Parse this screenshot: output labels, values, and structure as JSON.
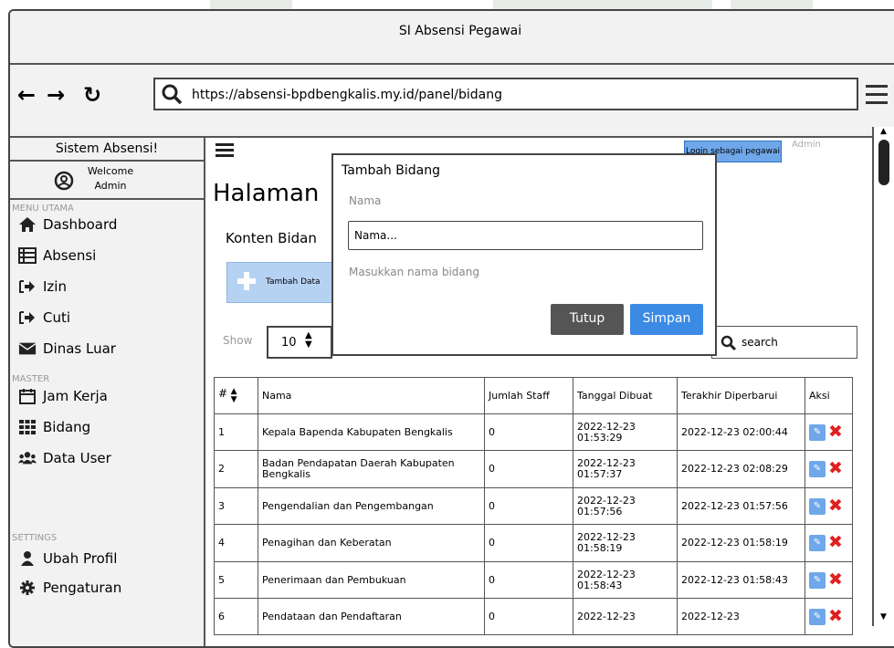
{
  "window": {
    "title": "SI Absensi Pegawai"
  },
  "browser": {
    "url": "https://absensi-bpdbengkalis.my.id/panel/bidang"
  },
  "sidebar": {
    "title": "Sistem Absensi!",
    "welcome_line1": "Welcome",
    "welcome_line2": "Admin",
    "section_main": "MENU UTAMA",
    "section_master": "MASTER",
    "section_settings": "SETTINGS",
    "items": [
      {
        "label": "Dashboard",
        "icon": "home-icon"
      },
      {
        "label": "Absensi",
        "icon": "list-icon"
      },
      {
        "label": "Izin",
        "icon": "sign-in-icon"
      },
      {
        "label": "Cuti",
        "icon": "sign-in-icon"
      },
      {
        "label": "Dinas Luar",
        "icon": "envelope-icon"
      },
      {
        "label": "Jam Kerja",
        "icon": "calendar-icon"
      },
      {
        "label": "Bidang",
        "icon": "grid-icon"
      },
      {
        "label": "Data User",
        "icon": "users-icon"
      },
      {
        "label": "Ubah Profil",
        "icon": "user-icon"
      },
      {
        "label": "Pengaturan",
        "icon": "gear-icon"
      }
    ]
  },
  "header": {
    "login_badge": "Login sebagai pegawai",
    "role": "Admin"
  },
  "main": {
    "page_title": "Halaman",
    "section_title": "Konten Bidan",
    "add_button": "Tambah Data",
    "show_label": "Show",
    "show_value": "10",
    "search_placeholder": "search"
  },
  "modal": {
    "title": "Tambah Bidang",
    "field_label": "Nama",
    "input_placeholder": "Nama...",
    "help_text": "Masukkan nama bidang",
    "close_button": "Tutup",
    "save_button": "Simpan"
  },
  "table": {
    "headers": {
      "no": "#",
      "nama": "Nama",
      "jumlah": "Jumlah Staff",
      "dibuat": "Tanggal Dibuat",
      "diperbarui": "Terakhir Diperbarui",
      "aksi": "Aksi"
    },
    "rows": [
      {
        "no": "1",
        "nama": "Kepala Bapenda Kabupaten Bengkalis",
        "jumlah": "0",
        "dibuat": "2022-12-23 01:53:29",
        "diperbarui": "2022-12-23 02:00:44"
      },
      {
        "no": "2",
        "nama": "Badan Pendapatan Daerah Kabupaten Bengkalis",
        "jumlah": "0",
        "dibuat": "2022-12-23 01:57:37",
        "diperbarui": "2022-12-23 02:08:29"
      },
      {
        "no": "3",
        "nama": "Pengendalian dan Pengembangan",
        "jumlah": "0",
        "dibuat": "2022-12-23 01:57:56",
        "diperbarui": "2022-12-23 01:57:56"
      },
      {
        "no": "4",
        "nama": "Penagihan dan Keberatan",
        "jumlah": "0",
        "dibuat": "2022-12-23 01:58:19",
        "diperbarui": "2022-12-23 01:58:19"
      },
      {
        "no": "5",
        "nama": "Penerimaan dan Pembukuan",
        "jumlah": "0",
        "dibuat": "2022-12-23 01:58:43",
        "diperbarui": "2022-12-23 01:58:43"
      },
      {
        "no": "6",
        "nama": "Pendataan dan Pendaftaran",
        "jumlah": "0",
        "dibuat": "2022-12-23",
        "diperbarui": "2022-12-23"
      }
    ]
  },
  "colors": {
    "accent": "#3b8be5",
    "danger": "#e02020",
    "dark_button": "#555555",
    "badge": "#6fa7ea"
  }
}
